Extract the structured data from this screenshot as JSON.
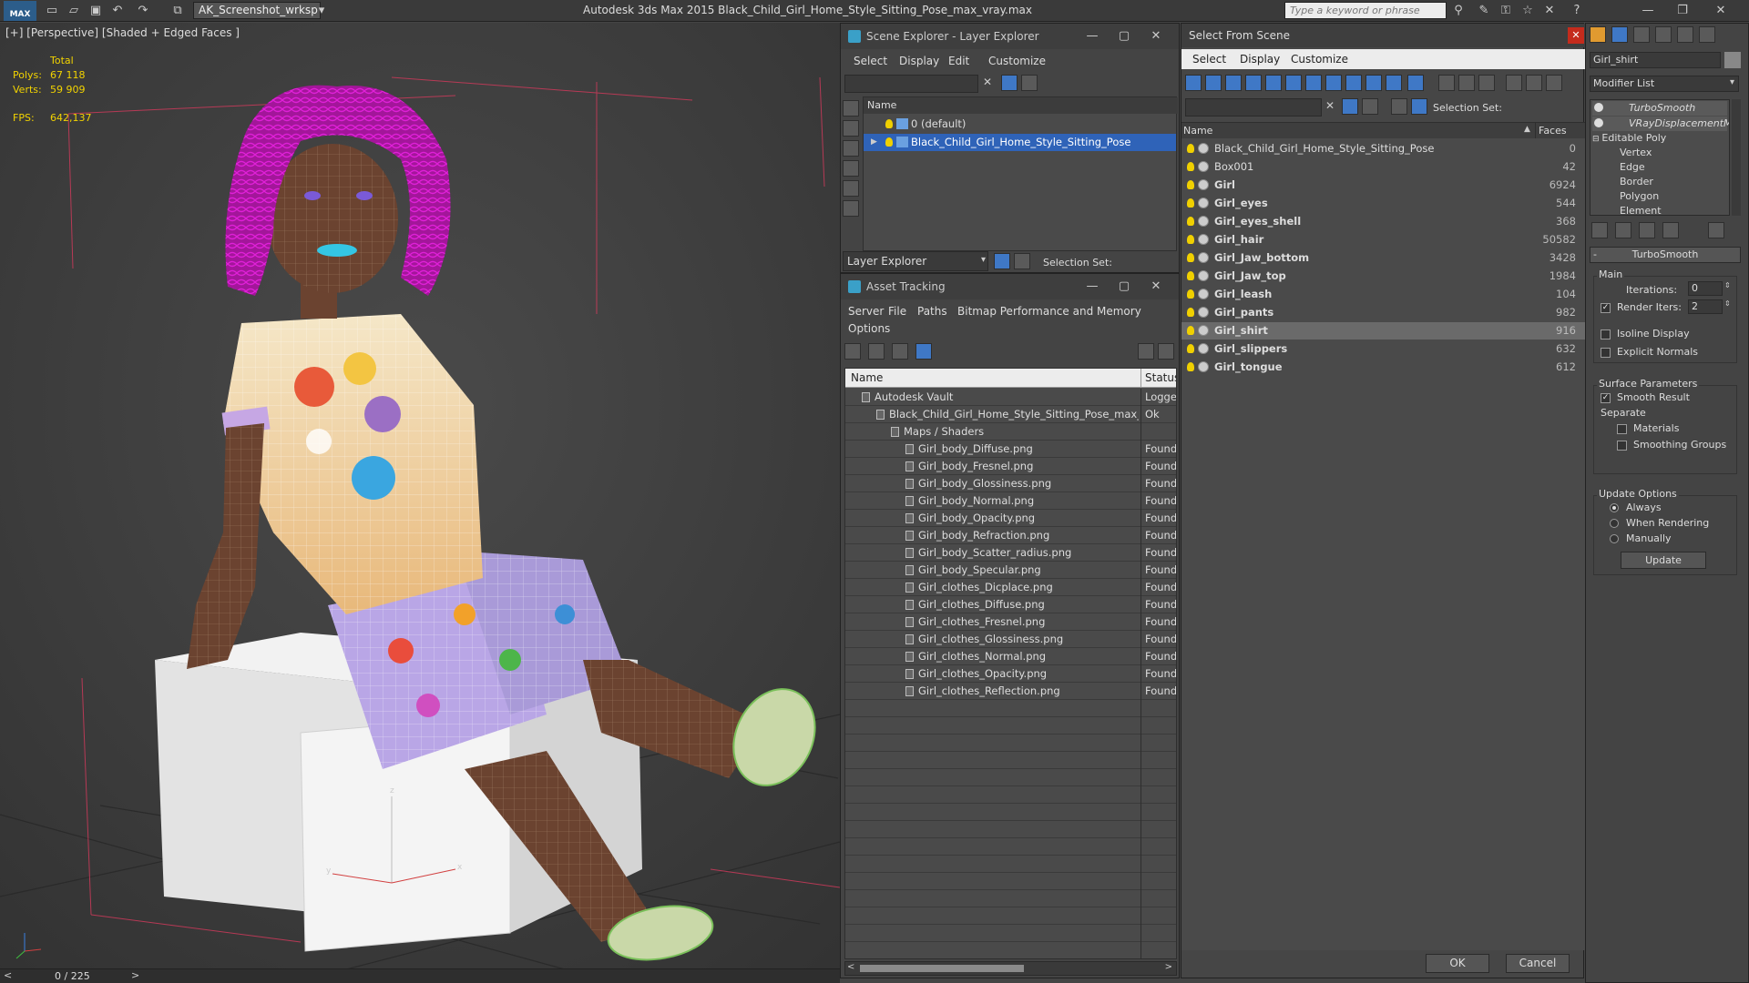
{
  "app": {
    "logo_text": "MAX",
    "workspace": "AK_Screenshot_wrksp",
    "title": "Autodesk 3ds Max  2015    Black_Child_Girl_Home_Style_Sitting_Pose_max_vray.max",
    "search_placeholder": "Type a keyword or phrase"
  },
  "viewport": {
    "label": "[+] [Perspective] [Shaded + Edged Faces ]",
    "stats": {
      "total_label": "Total",
      "polys_label": "Polys:",
      "polys_value": "67 118",
      "verts_label": "Verts:",
      "verts_value": "59 909",
      "fps_label": "FPS:",
      "fps_value": "642,137"
    },
    "frame_counter": "0 / 225"
  },
  "scene_explorer": {
    "title": "Scene Explorer - Layer Explorer",
    "menu": [
      "Select",
      "Display",
      "Edit",
      "Customize"
    ],
    "col_name": "Name",
    "rows": [
      "0 (default)",
      "Black_Child_Girl_Home_Style_Sitting_Pose"
    ],
    "footer_explorer": "Layer Explorer",
    "footer_selection": "Selection Set:"
  },
  "asset_tracking": {
    "title": "Asset Tracking",
    "menu": [
      "Server",
      "File",
      "Paths",
      "Bitmap Performance and Memory",
      "Options"
    ],
    "col_name": "Name",
    "col_status": "Status",
    "rows": [
      {
        "name": "Autodesk Vault",
        "status": "Logged",
        "indent": 0
      },
      {
        "name": "Black_Child_Girl_Home_Style_Sitting_Pose_max_...",
        "status": "Ok",
        "indent": 1
      },
      {
        "name": "Maps / Shaders",
        "status": "",
        "indent": 2
      },
      {
        "name": "Girl_body_Diffuse.png",
        "status": "Found",
        "indent": 3
      },
      {
        "name": "Girl_body_Fresnel.png",
        "status": "Found",
        "indent": 3
      },
      {
        "name": "Girl_body_Glossiness.png",
        "status": "Found",
        "indent": 3
      },
      {
        "name": "Girl_body_Normal.png",
        "status": "Found",
        "indent": 3
      },
      {
        "name": "Girl_body_Opacity.png",
        "status": "Found",
        "indent": 3
      },
      {
        "name": "Girl_body_Refraction.png",
        "status": "Found",
        "indent": 3
      },
      {
        "name": "Girl_body_Scatter_radius.png",
        "status": "Found",
        "indent": 3
      },
      {
        "name": "Girl_body_Specular.png",
        "status": "Found",
        "indent": 3
      },
      {
        "name": "Girl_clothes_Dicplace.png",
        "status": "Found",
        "indent": 3
      },
      {
        "name": "Girl_clothes_Diffuse.png",
        "status": "Found",
        "indent": 3
      },
      {
        "name": "Girl_clothes_Fresnel.png",
        "status": "Found",
        "indent": 3
      },
      {
        "name": "Girl_clothes_Glossiness.png",
        "status": "Found",
        "indent": 3
      },
      {
        "name": "Girl_clothes_Normal.png",
        "status": "Found",
        "indent": 3
      },
      {
        "name": "Girl_clothes_Opacity.png",
        "status": "Found",
        "indent": 3
      },
      {
        "name": "Girl_clothes_Reflection.png",
        "status": "Found",
        "indent": 3
      }
    ]
  },
  "select_from_scene": {
    "title": "Select From Scene",
    "menu": [
      "Select",
      "Display",
      "Customize"
    ],
    "selection_set_label": "Selection Set:",
    "col_name": "Name",
    "col_faces": "Faces",
    "rows": [
      {
        "name": "Black_Child_Girl_Home_Style_Sitting_Pose",
        "faces": "0",
        "bold": false
      },
      {
        "name": "Box001",
        "faces": "42",
        "bold": false
      },
      {
        "name": "Girl",
        "faces": "6924",
        "bold": true
      },
      {
        "name": "Girl_eyes",
        "faces": "544",
        "bold": true
      },
      {
        "name": "Girl_eyes_shell",
        "faces": "368",
        "bold": true
      },
      {
        "name": "Girl_hair",
        "faces": "50582",
        "bold": true
      },
      {
        "name": "Girl_Jaw_bottom",
        "faces": "3428",
        "bold": true
      },
      {
        "name": "Girl_Jaw_top",
        "faces": "1984",
        "bold": true
      },
      {
        "name": "Girl_leash",
        "faces": "104",
        "bold": true
      },
      {
        "name": "Girl_pants",
        "faces": "982",
        "bold": true
      },
      {
        "name": "Girl_shirt",
        "faces": "916",
        "bold": true
      },
      {
        "name": "Girl_slippers",
        "faces": "632",
        "bold": true
      },
      {
        "name": "Girl_tongue",
        "faces": "612",
        "bold": true
      }
    ],
    "ok": "OK",
    "cancel": "Cancel"
  },
  "modify_panel": {
    "object_name": "Girl_shirt",
    "modifier_list": "Modifier List",
    "stack": [
      "TurboSmooth",
      "VRayDisplacementMo",
      "Editable Poly",
      "Vertex",
      "Edge",
      "Border",
      "Polygon",
      "Element"
    ],
    "rollout_title": "TurboSmooth",
    "main_label": "Main",
    "iterations_label": "Iterations:",
    "iterations_value": "0",
    "render_iters_label": "Render Iters:",
    "render_iters_value": "2",
    "isoline": "Isoline Display",
    "explicit_normals": "Explicit Normals",
    "surface_params": "Surface Parameters",
    "smooth_result": "Smooth Result",
    "separate": "Separate",
    "materials": "Materials",
    "smoothing_groups": "Smoothing Groups",
    "update_options": "Update Options",
    "always": "Always",
    "when_rendering": "When Rendering",
    "manually": "Manually",
    "update_button": "Update"
  },
  "colors": {
    "selection_blue": "#2f63b8",
    "stats_yellow": "#f2d300",
    "hair_magenta": "#d21ec8"
  }
}
